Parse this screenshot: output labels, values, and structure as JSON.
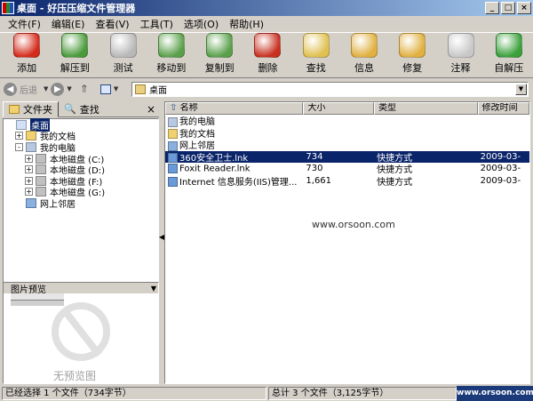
{
  "window": {
    "title": "桌面 - 好压压缩文件管理器",
    "min": "_",
    "max": "□",
    "close": "×"
  },
  "menu": [
    "文件(F)",
    "编辑(E)",
    "查看(V)",
    "工具(T)",
    "选项(O)",
    "帮助(H)"
  ],
  "toolbar": [
    {
      "label": "添加",
      "icon": "add-archive-icon",
      "color": "#d42a1a"
    },
    {
      "label": "解压到",
      "icon": "extract-icon",
      "color": "#4a9a3a"
    },
    {
      "label": "测试",
      "icon": "test-gear-icon",
      "color": "#b8b8b8"
    },
    {
      "label": "移动到",
      "icon": "move-to-icon",
      "color": "#5aa04a"
    },
    {
      "label": "复制到",
      "icon": "copy-to-icon",
      "color": "#5aa04a"
    },
    {
      "label": "删除",
      "icon": "delete-trash-icon",
      "color": "#c83020"
    },
    {
      "label": "查找",
      "icon": "find-magnifier-icon",
      "color": "#e0c050"
    },
    {
      "label": "信息",
      "icon": "info-icon",
      "color": "#e0b040"
    },
    {
      "label": "修复",
      "icon": "repair-wrench-icon",
      "color": "#e0b040"
    },
    {
      "label": "注释",
      "icon": "comment-note-icon",
      "color": "#c8c8c8"
    },
    {
      "label": "自解压",
      "icon": "self-extract-icon",
      "color": "#3aa03a"
    }
  ],
  "nav": {
    "back": "后退",
    "address": "桌面"
  },
  "left_panel": {
    "tab_folders": "文件夹",
    "tab_find": "查找",
    "tree": [
      {
        "label": "桌面",
        "level": 0,
        "expander": "",
        "selected": true,
        "icon": "desktop-icon"
      },
      {
        "label": "我的文档",
        "level": 1,
        "expander": "+",
        "icon": "my-documents-icon"
      },
      {
        "label": "我的电脑",
        "level": 1,
        "expander": "-",
        "icon": "my-computer-icon"
      },
      {
        "label": "本地磁盘 (C:)",
        "level": 2,
        "expander": "+",
        "icon": "drive-icon"
      },
      {
        "label": "本地磁盘 (D:)",
        "level": 2,
        "expander": "+",
        "icon": "drive-icon"
      },
      {
        "label": "本地磁盘 (F:)",
        "level": 2,
        "expander": "+",
        "icon": "drive-icon"
      },
      {
        "label": "本地磁盘 (G:)",
        "level": 2,
        "expander": "+",
        "icon": "drive-icon"
      },
      {
        "label": "网上邻居",
        "level": 1,
        "expander": "",
        "icon": "network-icon"
      }
    ],
    "preview_title": "图片预览",
    "no_preview": "无预览图"
  },
  "columns": [
    "名称",
    "大小",
    "类型",
    "修改时间"
  ],
  "files": [
    {
      "name": "我的电脑",
      "size": "",
      "type": "",
      "date": "",
      "icon": "my-computer-icon",
      "selected": false
    },
    {
      "name": "我的文档",
      "size": "",
      "type": "",
      "date": "",
      "icon": "my-documents-icon",
      "selected": false
    },
    {
      "name": "网上邻居",
      "size": "",
      "type": "",
      "date": "",
      "icon": "network-icon",
      "selected": false
    },
    {
      "name": "360安全卫士.lnk",
      "size": "734",
      "type": "快捷方式",
      "date": "2009-03-",
      "icon": "shortcut-icon",
      "selected": true
    },
    {
      "name": "Foxit Reader.lnk",
      "size": "730",
      "type": "快捷方式",
      "date": "2009-03-",
      "icon": "shortcut-icon",
      "selected": false
    },
    {
      "name": "Internet 信息服务(IIS)管理...",
      "size": "1,661",
      "type": "快捷方式",
      "date": "2009-03-",
      "icon": "shortcut-icon",
      "selected": false
    }
  ],
  "watermark": "www.orsoon.com",
  "status": {
    "selected": "已经选择 1 个文件（734字节）",
    "total": "总计 3 个文件（3,125字节）",
    "brand": "www.orsoon.com"
  }
}
